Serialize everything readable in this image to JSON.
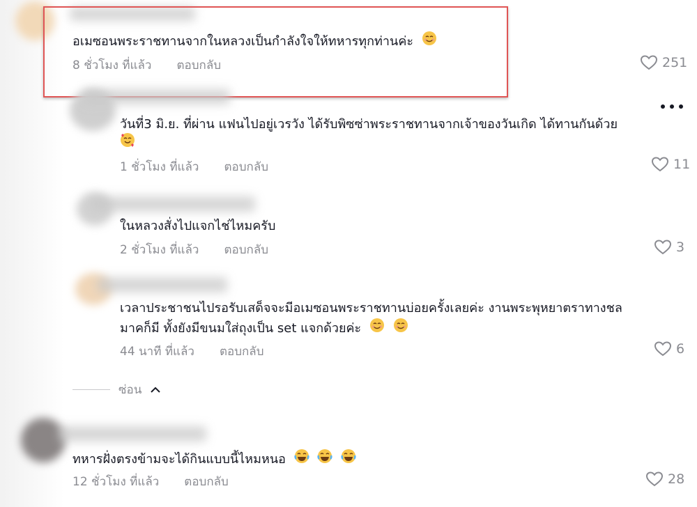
{
  "comments": [
    {
      "text": "อเมซอนพระราชทานจากในหลวงเป็นกำลังใจให้ทหารทุกท่านค่ะ",
      "emoji": "smiling-face",
      "time": "8 ชั่วโมง ที่แล้ว",
      "reply": "ตอบกลับ",
      "likes": "251"
    },
    {
      "text": "วันที่3 มิ.ย. ที่ผ่าน แฟนไปอยู่เวรวัง ได้รับพิซซ่าพระราชทานจากเจ้าของวันเกิด ได้ทานกันด้วย",
      "emoji": "smiling-face-with-hearts",
      "time": "1 ชั่วโมง ที่แล้ว",
      "reply": "ตอบกลับ",
      "likes": "11"
    },
    {
      "text": "ในหลวงสั่งไปแจกไช่ไหมครับ",
      "time": "2 ชั่วโมง ที่แล้ว",
      "reply": "ตอบกลับ",
      "likes": "3"
    },
    {
      "text_line1": "เวลาประชาชนไปรอรับเสด็จจะมีอเมซอนพระราชทานบ่อยครั้งเลยค่ะ งานพระพุหยาตราทางชล",
      "text_line2": "มาคก็มี ทั้งยังมีขนมใส่ถุงเป็น set แจกด้วยค่ะ",
      "emoji": "smiling-face",
      "time": "44 นาที ที่แล้ว",
      "reply": "ตอบกลับ",
      "likes": "6"
    },
    {
      "text": "ทหารฝั่งตรงข้ามจะได้กินแบบนี้ไหมหนอ",
      "emoji": "face-with-tears-of-joy",
      "time": "12 ชั่วโมง ที่แล้ว",
      "reply": "ตอบกลับ",
      "likes": "28"
    }
  ],
  "hide_label": "ซ่อน",
  "colors": {
    "highlight": "#e05555",
    "muted": "#8a8b91",
    "text": "#161823"
  },
  "icons": [
    "heart-icon",
    "more-icon",
    "chevron-up-icon"
  ]
}
